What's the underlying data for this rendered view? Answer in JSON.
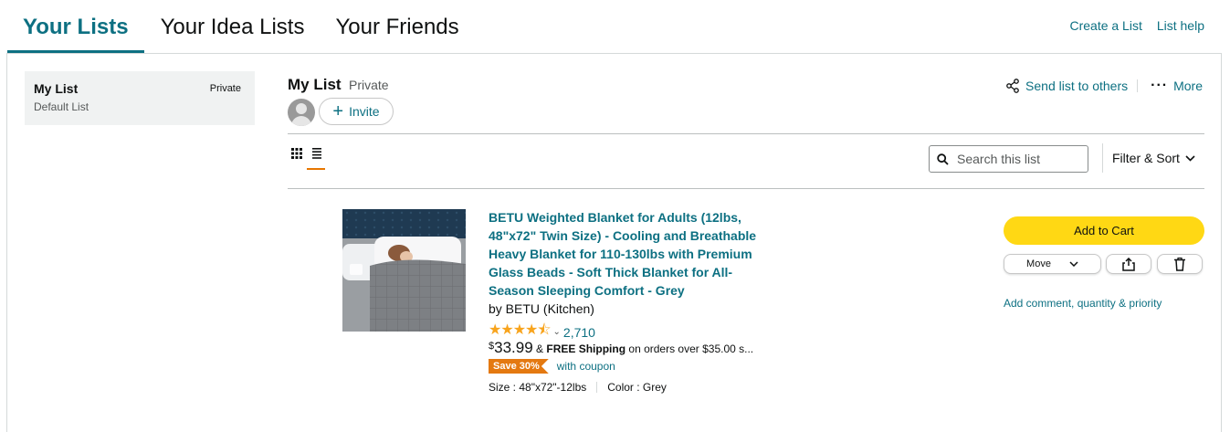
{
  "tabs": [
    {
      "label": "Your Lists",
      "active": true
    },
    {
      "label": "Your Idea Lists",
      "active": false
    },
    {
      "label": "Your Friends",
      "active": false
    }
  ],
  "top_links": {
    "create": "Create a List",
    "help": "List help"
  },
  "sidebar": {
    "list_name": "My List",
    "privacy": "Private",
    "subtitle": "Default List"
  },
  "list_header": {
    "title": "My List",
    "privacy": "Private",
    "invite_label": "Invite",
    "send_label": "Send list to others",
    "more_label": "More"
  },
  "toolbar": {
    "search_placeholder": "Search this list",
    "filter_sort_label": "Filter & Sort"
  },
  "item": {
    "title": "BETU Weighted Blanket for Adults (12lbs, 48\"x72\" Twin Size) - Cooling and Breathable Heavy Blanket for 110-130lbs with Premium Glass Beads - Soft Thick Blanket for All-Season Sleeping Comfort - Grey",
    "by": "by BETU (Kitchen)",
    "rating_stars": 4.5,
    "rating_count": "2,710",
    "price_symbol": "$",
    "price_value": "33.99",
    "shipping_prefix": "&",
    "shipping_bold": "FREE Shipping",
    "shipping_rest": "on orders over $35.00 s...",
    "coupon_badge": "Save 30%",
    "coupon_text": "with coupon",
    "size": "Size : 48\"x72\"-12lbs",
    "color": "Color : Grey"
  },
  "actions": {
    "add_to_cart": "Add to Cart",
    "move_label": "Move",
    "add_comment": "Add comment, quantity & priority"
  },
  "colors": {
    "link": "#0d7082",
    "add_to_cart_bg": "#ffd814",
    "coupon_bg": "#e47911",
    "star": "#f8a41d",
    "view_underline": "#e77600"
  }
}
